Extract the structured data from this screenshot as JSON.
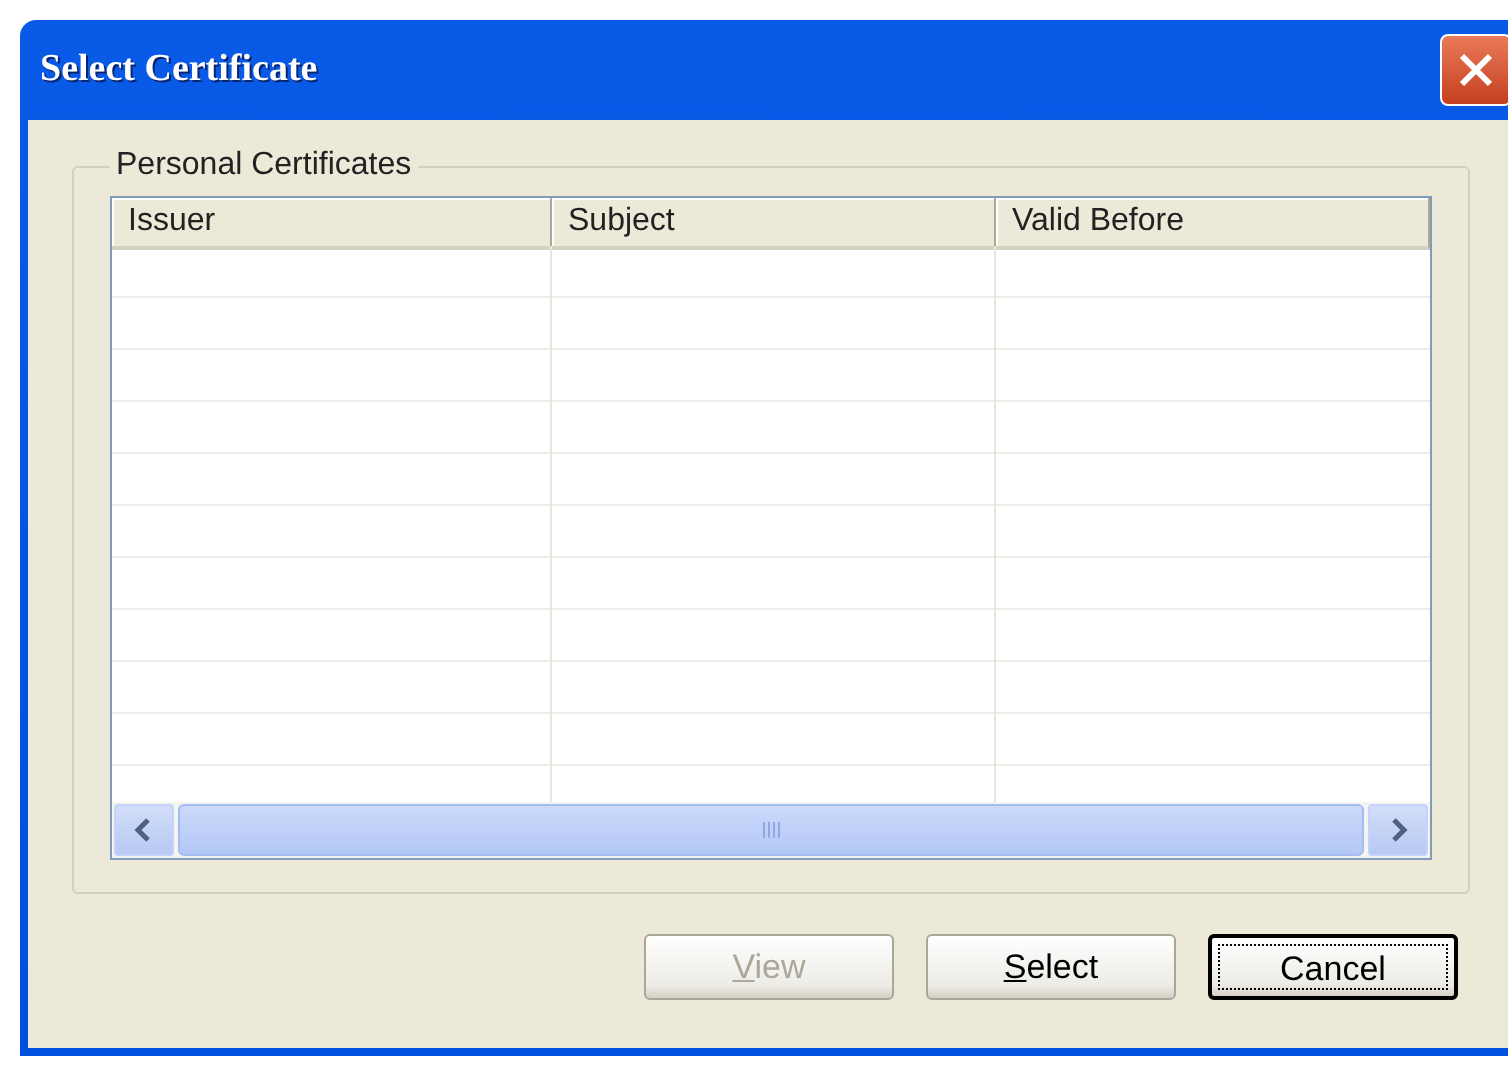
{
  "window": {
    "title": "Select Certificate"
  },
  "group": {
    "label": "Personal Certificates"
  },
  "table": {
    "columns": [
      "Issuer",
      "Subject",
      "Valid Before"
    ]
  },
  "buttons": [
    {
      "mnemonic": "V",
      "rest": "iew",
      "disabled": true,
      "focused": false
    },
    {
      "mnemonic": "S",
      "rest": "elect",
      "disabled": false,
      "focused": false
    },
    {
      "rest": "Cancel",
      "disabled": false,
      "focused": true
    }
  ]
}
